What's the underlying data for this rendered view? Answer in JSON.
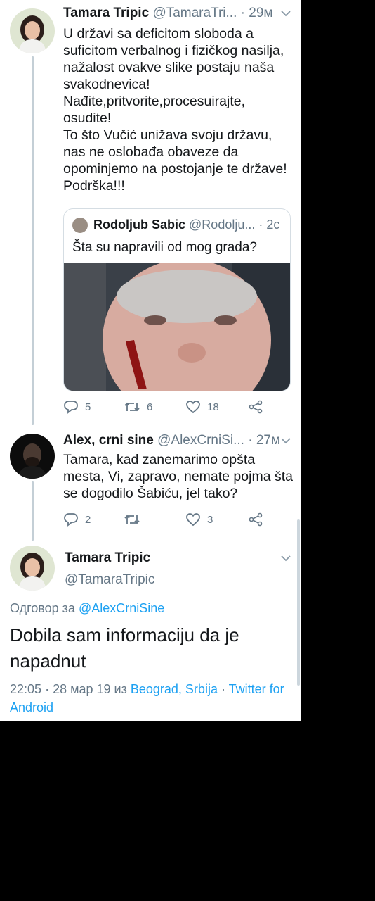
{
  "tweet1": {
    "name": "Tamara Tripic",
    "handle": "@TamaraTri...",
    "dot": "·",
    "time": "29м",
    "text": "U državi sa deficitom sloboda a\nsuficitom verbalnog i fizičkog nasilja,\nnažalost ovakve slike postaju naša\nsvakodnevica!\nNađite,pritvorite,procesuirajte,\nosudite!\nTo što Vučić unižava svoju državu,\nnas ne oslobađa obaveze da\nopominjemo na postojanje te države!\nPodrška!!!",
    "quote": {
      "name": "Rodoljub Sabic",
      "handle": "@Rodolju...",
      "dot": "·",
      "time": "2c",
      "text": "Šta su napravili od mog grada?"
    },
    "replies": "5",
    "retweets": "6",
    "likes": "18"
  },
  "tweet2": {
    "name": "Alex, crni sine",
    "handle": "@AlexCrniSi...",
    "dot": "·",
    "time": "27м",
    "text": "Tamara, kad zanemarimo opšta\nmesta, Vi, zapravo, nemate pojma šta\nse dogodilo Šabiću, jel tako?",
    "replies": "2",
    "retweets": "",
    "likes": "3"
  },
  "tweet3": {
    "name": "Tamara Tripic",
    "handle": "@TamaraTripic",
    "replying_prefix": "Одговор за",
    "replying_to": "@AlexCrniSine",
    "text": "Dobila sam informaciju da je napadnut",
    "time": "22:05",
    "sep1": "·",
    "date": "28 мар 19",
    "from_word": "из",
    "location": "Beograd, Srbija",
    "sep2": "·",
    "source": "Twitter for Android"
  },
  "icons": [
    "reply-icon",
    "retweet-icon",
    "like-icon",
    "share-icon",
    "chevron-down-icon"
  ],
  "colors": {
    "link": "#1da1f2",
    "secondary": "#657786",
    "text": "#14171a",
    "thread": "#c4cfd6"
  }
}
